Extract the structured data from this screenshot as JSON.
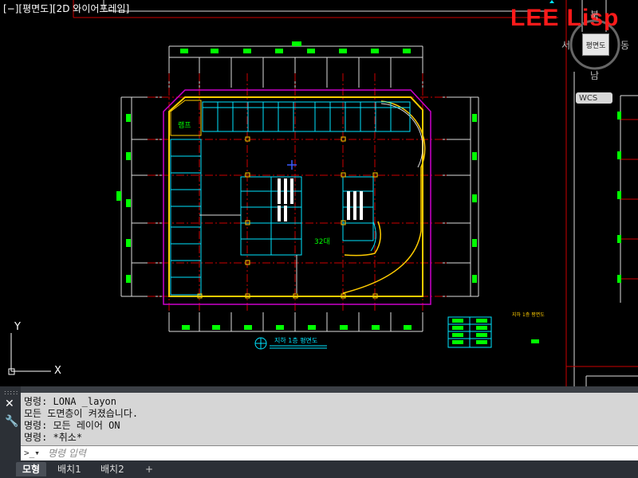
{
  "viewport": {
    "view_label": "[−][평면도][2D 와이어프레임]",
    "watermark": "LEE Lisp",
    "viewcube": {
      "north": "북",
      "west": "서",
      "east": "동",
      "south": "남",
      "face": "평면도"
    },
    "wcs_label": "WCS",
    "drawing_texts": {
      "room_label": "램프",
      "parking_count": "32대",
      "plan_title": "지하 1층 평면도",
      "small_title": "지하 1층 평면도"
    },
    "ucs": {
      "x": "X",
      "y": "Y"
    }
  },
  "colors": {
    "background": "#000000",
    "grid_red": "#cc0000",
    "parking_cyan": "#00e5ff",
    "wall_yellow": "#ffcc00",
    "boundary_magenta": "#cc00cc",
    "dim_white": "#ffffff",
    "tag_green": "#00ff00"
  },
  "command_panel": {
    "history": [
      "명령: LONA _layon",
      "모든 도면층이 켜졌습니다.",
      "명령: 모든 레이어 ON",
      "명령: *취소*"
    ],
    "input_placeholder": "명령 입력",
    "close_icon": "close-icon",
    "settings_icon": "wrench-icon"
  },
  "tabs": {
    "model": "모형",
    "layout1": "배치1",
    "layout2": "배치2",
    "add": "+"
  }
}
